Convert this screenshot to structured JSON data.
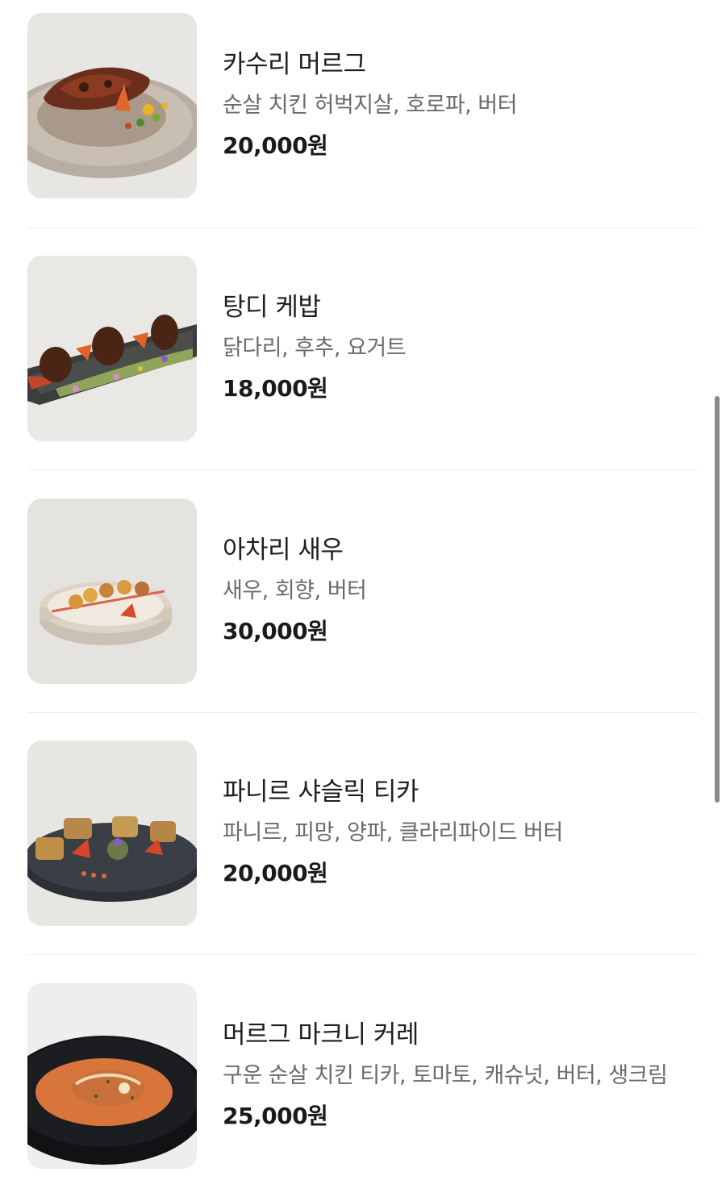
{
  "menu": {
    "items": [
      {
        "name": "카수리 머르그",
        "description": "순살 치킨 허벅지살, 호로파, 버터",
        "price": "20,000원",
        "image_icon": "grilled-chicken-on-ribbed-plate"
      },
      {
        "name": "탕디 케밥",
        "description": "닭다리, 후추, 요거트",
        "price": "18,000원",
        "image_icon": "chicken-drumsticks-on-slate-tray"
      },
      {
        "name": "아차리 새우",
        "description": "새우, 회향, 버터",
        "price": "30,000원",
        "image_icon": "shrimp-in-ceramic-bowl"
      },
      {
        "name": "파니르 샤슬릭 티카",
        "description": "파니르, 피망, 양파, 클라리파이드 버터",
        "price": "20,000원",
        "image_icon": "paneer-tikka-on-dark-plate"
      },
      {
        "name": "머르그 마크니 커레",
        "description": "구운 순살 치킨 티카, 토마토, 캐슈넛, 버터, 생크림",
        "price": "25,000원",
        "image_icon": "butter-chicken-curry-bowl"
      }
    ]
  },
  "colors": {
    "title": "#1f1f1f",
    "description": "#6b6b6b",
    "price": "#1a1a1a",
    "divider": "#ededed",
    "scrollbar": "#8a8a8a"
  }
}
